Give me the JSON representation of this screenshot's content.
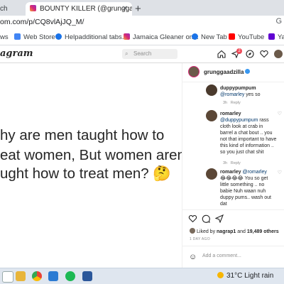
{
  "browser": {
    "tabs": [
      {
        "label": "ch",
        "active": false
      },
      {
        "label": "BOUNTY KILLER (@grunggaadzill",
        "active": true
      }
    ],
    "close_glyph": "✕",
    "new_tab_glyph": "+",
    "url": "om.com/p/CQ8vlAjJQ_M/",
    "address_right_glyph": "G",
    "bookmarks": [
      {
        "label": "ws",
        "icon": "apps-icon",
        "color": "#1a73e8"
      },
      {
        "label": "Web Store",
        "icon": "web-store-icon",
        "color": "#4285f4"
      },
      {
        "label": "Helpadditional tabs...",
        "icon": "globe-icon",
        "color": "#1a73e8"
      },
      {
        "label": "Jamaica Gleaner on...",
        "icon": "instagram-icon",
        "color": "#d62976"
      },
      {
        "label": "New Tab",
        "icon": "globe-icon",
        "color": "#1a73e8"
      },
      {
        "label": "YouTube",
        "icon": "youtube-icon",
        "color": "#ff0000"
      },
      {
        "label": "Yah",
        "icon": "yahoo-icon",
        "color": "#6001d2"
      }
    ]
  },
  "instagram": {
    "logo": "agram",
    "search_placeholder": "Search",
    "notification_count": "2"
  },
  "post": {
    "text_lines": [
      "hy are men taught how to",
      "eat women, But women aren’t",
      "ught how to treat men? 🤔"
    ],
    "author": "grunggaadzilla",
    "comments": [
      {
        "user": "duppypumpum",
        "text_prefix": "",
        "mention": "@romarley",
        "text": " yes so",
        "time": "3h",
        "reply": "Reply"
      },
      {
        "user": "romarley",
        "text_prefix": "",
        "mention": "@duppypumpum",
        "text": " rass cloth look at crab in barrel a chat bout .. you not that important to have this kind of information .. so you just chat shit",
        "time": "3h",
        "reply": "Reply"
      },
      {
        "user": "romarley",
        "text_prefix": "",
        "mention": "@romarley",
        "text": "😂😂😂😂 You so get little something .. no babie Nuh waan nuh duppy pums.. wash out dat",
        "time": "",
        "reply": ""
      }
    ],
    "likes_text_prefix": "Liked by ",
    "likes_user": "nagrap1",
    "likes_mid": " and ",
    "likes_count": "19,489 others",
    "date": "1 DAY AGO",
    "add_comment_placeholder": "Add a comment...",
    "emoji_glyph": "☺"
  },
  "taskbar": {
    "weather": "31°C  Light rain"
  },
  "colors": {
    "accent": "#0095f6",
    "verified": "#3897f0",
    "instagram_gradient_start": "#f9a13a",
    "instagram_gradient_end": "#962fbf"
  }
}
